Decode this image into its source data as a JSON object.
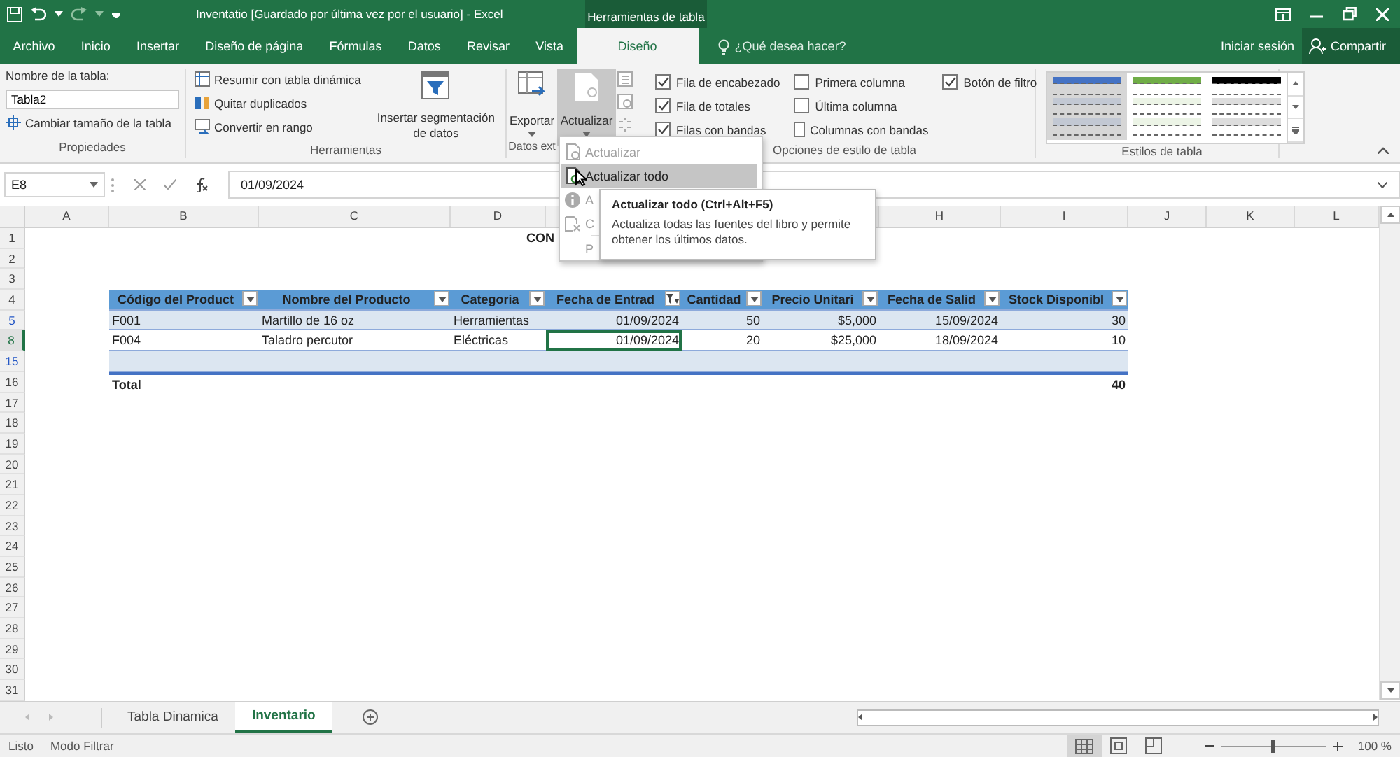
{
  "title_bar": {
    "title": "Inventatio [Guardado por última vez por el usuario] - Excel",
    "context_label": "Herramientas de tabla"
  },
  "ribbon_tabs": [
    {
      "label": "Archivo",
      "selected": false
    },
    {
      "label": "Inicio",
      "selected": false
    },
    {
      "label": "Insertar",
      "selected": false
    },
    {
      "label": "Diseño de página",
      "selected": false
    },
    {
      "label": "Fórmulas",
      "selected": false
    },
    {
      "label": "Datos",
      "selected": false
    },
    {
      "label": "Revisar",
      "selected": false
    },
    {
      "label": "Vista",
      "selected": false
    },
    {
      "label": "Diseño",
      "selected": true
    }
  ],
  "tell_me": "¿Qué desea hacer?",
  "account": {
    "sign_in": "Iniciar sesión",
    "share": "Compartir"
  },
  "ribbon": {
    "properties": {
      "group": "Propiedades",
      "name_label": "Nombre de la tabla:",
      "name_value": "Tabla2",
      "resize": "Cambiar tamaño de la tabla"
    },
    "tools": {
      "group": "Herramientas",
      "items": [
        "Resumir con tabla dinámica",
        "Quitar duplicados",
        "Convertir en rango"
      ],
      "slicer": "Insertar segmentación de datos"
    },
    "external": {
      "group": "Datos ext",
      "export": "Exportar",
      "refresh": "Actualizar",
      "refresh_pressed": true
    },
    "style_options": {
      "group": "Opciones de estilo de tabla",
      "options": [
        {
          "label": "Fila de encabezado",
          "checked": true
        },
        {
          "label": "Fila de totales",
          "checked": true
        },
        {
          "label": "Filas con bandas",
          "checked": true
        },
        {
          "label": "Primera columna",
          "checked": false
        },
        {
          "label": "Última columna",
          "checked": false
        },
        {
          "label": "Columnas con bandas",
          "checked": false
        },
        {
          "label": "Botón de filtro",
          "checked": true
        }
      ]
    },
    "styles": {
      "group": "Estilos de tabla",
      "swatches": [
        {
          "color": "#4472c4",
          "selected": true
        },
        {
          "color": "#70ad47",
          "selected": false
        },
        {
          "color": "#000000",
          "selected": false
        }
      ]
    }
  },
  "dropdown_menu": {
    "items": [
      {
        "label": "Actualizar",
        "kind": "refresh",
        "disabled": true,
        "highlighted": false
      },
      {
        "label": "Actualizar todo",
        "kind": "refresh_all",
        "disabled": false,
        "highlighted": true
      },
      {
        "label": "A",
        "kind": "info",
        "disabled": true,
        "highlighted": false
      },
      {
        "label": "C",
        "kind": "clear",
        "disabled": true,
        "highlighted": false
      },
      {
        "label": "P",
        "kind": "plain",
        "disabled": true,
        "highlighted": false
      }
    ]
  },
  "tooltip": {
    "title": "Actualizar todo (Ctrl+Alt+F5)",
    "body": "Actualiza todas las fuentes del libro y permite obtener los últimos datos."
  },
  "formula_bar": {
    "name_box": "E8",
    "formula": "01/09/2024"
  },
  "columns": [
    "A",
    "B",
    "C",
    "D",
    null,
    null,
    null,
    "H",
    "I",
    "J",
    "K",
    "L"
  ],
  "sheet_rows": [
    {
      "number": "1",
      "kind": "title",
      "text": "CON",
      "filtered": false,
      "selected": false
    },
    {
      "number": "2",
      "kind": "empty",
      "filtered": false,
      "selected": false
    },
    {
      "number": "3",
      "kind": "empty",
      "filtered": false,
      "selected": false
    },
    {
      "number": "4",
      "kind": "table_header",
      "filtered": false,
      "selected": false,
      "headers": [
        {
          "label": "Código del Product",
          "filtered": false
        },
        {
          "label": "Nombre del Producto",
          "filtered": false
        },
        {
          "label": "Categoria",
          "filtered": false
        },
        {
          "label": "Fecha de Entrad",
          "filtered": true
        },
        {
          "label": "Cantidad",
          "filtered": false
        },
        {
          "label": "Precio Unitari",
          "filtered": false
        },
        {
          "label": "Fecha de Salid",
          "filtered": false
        },
        {
          "label": "Stock Disponibl",
          "filtered": false
        }
      ]
    },
    {
      "number": "5",
      "kind": "data",
      "banded": true,
      "filtered": true,
      "selected": false,
      "cells": [
        {
          "text": "F001",
          "selected": false
        },
        {
          "text": "Martillo de 16 oz",
          "selected": false
        },
        {
          "text": "Herramientas",
          "selected": false
        },
        {
          "text": "01/09/2024",
          "selected": false
        },
        {
          "text": "50",
          "selected": false
        },
        {
          "text": "$5,000",
          "selected": false
        },
        {
          "text": "15/09/2024",
          "selected": false
        },
        {
          "text": "30",
          "selected": false
        }
      ]
    },
    {
      "number": "8",
      "kind": "data",
      "banded": false,
      "filtered": true,
      "selected": true,
      "cells": [
        {
          "text": "F004",
          "selected": false
        },
        {
          "text": "Taladro percutor",
          "selected": false
        },
        {
          "text": "Eléctricas",
          "selected": false
        },
        {
          "text": "01/09/2024",
          "selected": true
        },
        {
          "text": "20",
          "selected": false
        },
        {
          "text": "$25,000",
          "selected": false
        },
        {
          "text": "18/09/2024",
          "selected": false
        },
        {
          "text": "10",
          "selected": false
        }
      ]
    },
    {
      "number": "15",
      "kind": "band",
      "filtered": true,
      "selected": false
    },
    {
      "number": "16",
      "kind": "total",
      "filtered": false,
      "selected": false,
      "label": "Total",
      "value": "40"
    },
    {
      "number": "17",
      "kind": "empty",
      "filtered": false,
      "selected": false
    },
    {
      "number": "18",
      "kind": "empty",
      "filtered": false,
      "selected": false
    },
    {
      "number": "19",
      "kind": "empty",
      "filtered": false,
      "selected": false
    },
    {
      "number": "20",
      "kind": "empty",
      "filtered": false,
      "selected": false
    },
    {
      "number": "21",
      "kind": "empty",
      "filtered": false,
      "selected": false
    },
    {
      "number": "22",
      "kind": "empty",
      "filtered": false,
      "selected": false
    },
    {
      "number": "23",
      "kind": "empty",
      "filtered": false,
      "selected": false
    },
    {
      "number": "24",
      "kind": "empty",
      "filtered": false,
      "selected": false
    },
    {
      "number": "25",
      "kind": "empty",
      "filtered": false,
      "selected": false
    },
    {
      "number": "26",
      "kind": "empty",
      "filtered": false,
      "selected": false
    },
    {
      "number": "27",
      "kind": "empty",
      "filtered": false,
      "selected": false
    },
    {
      "number": "28",
      "kind": "empty",
      "filtered": false,
      "selected": false
    },
    {
      "number": "29",
      "kind": "empty",
      "filtered": false,
      "selected": false
    },
    {
      "number": "30",
      "kind": "empty",
      "filtered": false,
      "selected": false
    },
    {
      "number": "31",
      "kind": "empty",
      "filtered": false,
      "selected": false
    }
  ],
  "sheet_tabs": [
    {
      "label": "Tabla Dinamica",
      "selected": false
    },
    {
      "label": "Inventario",
      "selected": true
    }
  ],
  "status_bar": {
    "ready": "Listo",
    "mode": "Modo Filtrar",
    "views": [
      {
        "kind": "normal",
        "selected": true
      },
      {
        "kind": "page_layout",
        "selected": false
      },
      {
        "kind": "page_break",
        "selected": false
      }
    ],
    "zoom": {
      "level": 0.5,
      "reading": "100 %"
    }
  }
}
